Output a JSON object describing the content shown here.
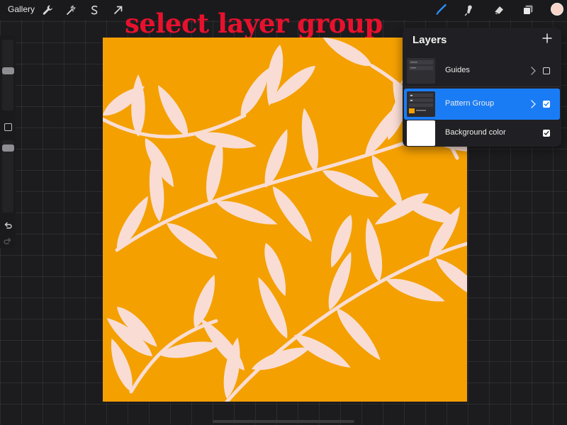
{
  "toolbar": {
    "gallery_label": "Gallery",
    "left_tools": [
      {
        "icon": "wrench-icon",
        "name": "actions"
      },
      {
        "icon": "magic-wand-icon",
        "name": "adjustments"
      },
      {
        "icon": "selection-icon",
        "name": "selection"
      },
      {
        "icon": "arrow-cursor-icon",
        "name": "transform"
      }
    ],
    "right_tools": [
      {
        "icon": "brush-icon",
        "name": "paint",
        "active": true
      },
      {
        "icon": "smudge-icon",
        "name": "smudge"
      },
      {
        "icon": "eraser-icon",
        "name": "erase"
      },
      {
        "icon": "layers-icon",
        "name": "layers"
      }
    ],
    "current_color": "#f9d4c8"
  },
  "annotation": {
    "headline": "select layer group",
    "color": "#e8112d"
  },
  "canvas": {
    "background_color": "#f4a000",
    "leaf_color": "#f9ddd4"
  },
  "layers_panel": {
    "title": "Layers",
    "add_icon": "plus-icon",
    "layers": [
      {
        "name": "Guides",
        "visible": false,
        "selected": false,
        "is_group": true
      },
      {
        "name": "Pattern Group",
        "visible": true,
        "selected": true,
        "is_group": true
      },
      {
        "name": "Background color",
        "visible": true,
        "selected": false,
        "is_group": false
      }
    ]
  },
  "colors": {
    "accent": "#1a7cf5",
    "panel": "#202024",
    "toolbar": "#1a1a1c"
  }
}
